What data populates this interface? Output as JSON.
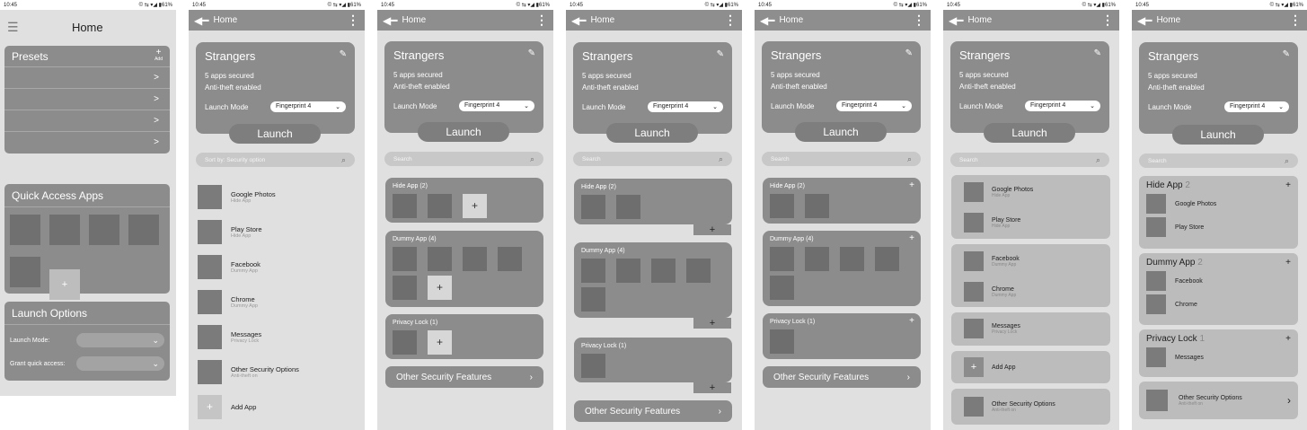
{
  "status": {
    "time": "10:45",
    "icons": "© ⇆ ▾◢ ▮61%"
  },
  "s1": {
    "title": "Home",
    "presets": "Presets",
    "add": "Add",
    "quick": "Quick Access Apps",
    "launch_opts": "Launch Options",
    "launch_mode": "Launch Mode:",
    "grant": "Grant quick access:"
  },
  "appbar": {
    "title": "Home"
  },
  "card": {
    "name": "Strangers",
    "line1": "5 apps secured",
    "line2": "Anti-theft enabled",
    "lm": "Launch Mode",
    "fp": "Fingerprint 4",
    "launch": "Launch"
  },
  "search": {
    "sort": "Sort by: Security option",
    "plain": "Search"
  },
  "apps": [
    {
      "n": "Google Photos",
      "s": "Hide App"
    },
    {
      "n": "Play Store",
      "s": "Hide App"
    },
    {
      "n": "Facebook",
      "s": "Dummy App"
    },
    {
      "n": "Chrome",
      "s": "Dummy App"
    },
    {
      "n": "Messages",
      "s": "Privacy Lock"
    },
    {
      "n": "Other Security Options",
      "s": "Anti-theft on"
    },
    {
      "n": "Add App",
      "s": ""
    }
  ],
  "groups": {
    "hide": "Hide App (2)",
    "dummy": "Dummy App (4)",
    "privacy": "Privacy Lock (1)",
    "osf": "Other Security Features"
  },
  "s7": {
    "hide": "Hide App",
    "hc": "2",
    "dummy": "Dummy App",
    "dc": "2",
    "priv": "Privacy Lock",
    "pc": "1",
    "gp": "Google Photos",
    "ps": "Play Store",
    "fb": "Facebook",
    "ch": "Chrome",
    "ms": "Messages",
    "oso": "Other Security Options",
    "on": "Anti-theft on"
  }
}
